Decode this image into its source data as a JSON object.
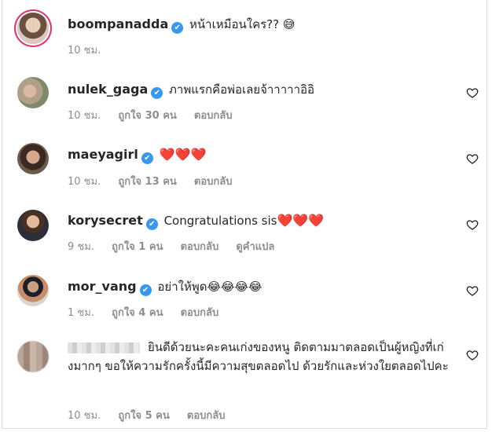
{
  "comments": [
    {
      "username": "boompanadda",
      "verified": true,
      "text": "หน้าเหมือนใคร??",
      "emoji": "😅",
      "time": "10 ชม.",
      "likes": "",
      "reply": "",
      "translate": ""
    },
    {
      "username": "nulek_gaga",
      "verified": true,
      "text": "ภาพแรกคือพ่อเลยจ้าาาาาอิอิ",
      "time": "10 ชม.",
      "likes": "ถูกใจ 30 คน",
      "reply": "ตอบกลับ"
    },
    {
      "username": "maeyagirl",
      "verified": true,
      "text": "",
      "emoji": "❤️❤️❤️",
      "time": "10 ชม.",
      "likes": "ถูกใจ 13 คน",
      "reply": "ตอบกลับ"
    },
    {
      "username": "korysecret",
      "verified": true,
      "text": "Congratulations sis",
      "emoji": "❤️❤️❤️",
      "time": "9 ชม.",
      "likes": "ถูกใจ 1 คน",
      "reply": "ตอบกลับ",
      "translate": "ดูคำแปล"
    },
    {
      "username": "mor_vang",
      "verified": true,
      "text": "อย่าให้พูด",
      "emoji": "😂😂😂😂",
      "time": "1 ชม.",
      "likes": "ถูกใจ 4 คน",
      "reply": "ตอบกลับ"
    },
    {
      "username": "",
      "verified": false,
      "text": "ยินดีด้วยนะคะคนเก่งของหนู ติดตามมาตลอดเป็นผู้หญิงที่เก่งมากๆ ขอให้ความรักครั้งนี้มีความสุขตลอดไป ด้วยรักและห่วงใยตลอดไปคะ",
      "time": "10 ชม.",
      "likes": "ถูกใจ 5 คน",
      "reply": "ตอบกลับ"
    }
  ],
  "icons": {
    "verified": "✔",
    "like": "heart-outline-icon"
  },
  "colors": {
    "verified_badge": "#3897f0",
    "meta_text": "#8e8e8e",
    "heart_emoji": "#e0192b",
    "story_ring": "#e1306c"
  }
}
